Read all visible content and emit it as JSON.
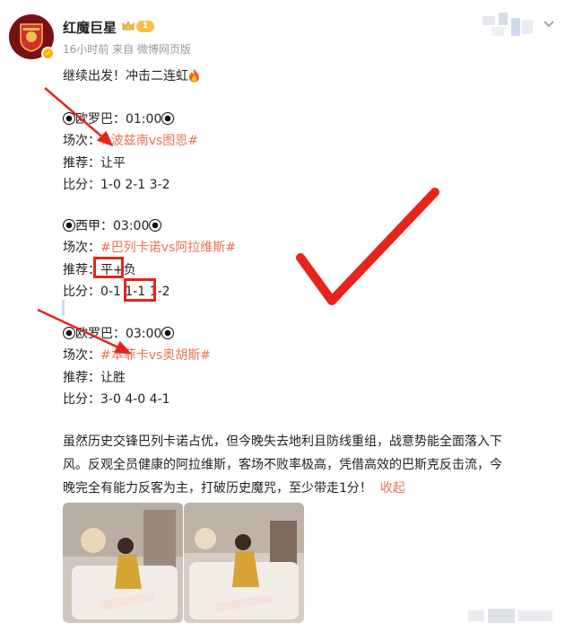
{
  "post": {
    "username": "红魔巨星",
    "vip_level": "1",
    "meta": "16小时前  来自 微博网页版",
    "intro": "继续出发！冲击二连虹",
    "fixtures": [
      {
        "league": "欧罗巴：01:00",
        "match_label": "场次：",
        "match_tag": "#波兹南vs图恩#",
        "pick_label": "推荐：",
        "pick": "让平",
        "score_label": "比分：",
        "scores": "1-0  2-1  3-2"
      },
      {
        "league": "西甲：03:00",
        "match_label": "场次：",
        "match_tag": "#巴列卡诺vs阿拉维斯#",
        "pick_label": "推荐：",
        "pick_a": "平",
        "pick_b": "+负",
        "score_label": "比分：",
        "score_a": "0-1",
        "score_b": "1-1",
        "score_c": "1-2"
      },
      {
        "league": "欧罗巴：03:00",
        "match_label": "场次：",
        "match_tag": "#本菲卡vs奥胡斯#",
        "pick_label": "推荐：",
        "pick": "让胜",
        "score_label": "比分：",
        "scores": "3-0  4-0  4-1"
      }
    ],
    "analysis_lines": [
      "虽然历史交锋巴列卡诺占优，但今晚失去地利且防线重组，战意势能全面落入下",
      "风。反观全员健康的阿拉维斯，客场不败率极高，凭借高效的巴斯克反击流，今",
      "晚完全有能力反客为主，打破历史魔咒，至少带走1分！"
    ],
    "collapse_label": "收起"
  },
  "colors": {
    "accent": "#eb7350",
    "annotation": "#e8231c",
    "vip": "#f5c04a"
  },
  "icons": [
    "crest-icon",
    "verified-icon",
    "crown-icon",
    "fire-icon",
    "soccer-ball-icon",
    "chevron-down-icon",
    "checkmark-icon",
    "arrow-icon"
  ]
}
